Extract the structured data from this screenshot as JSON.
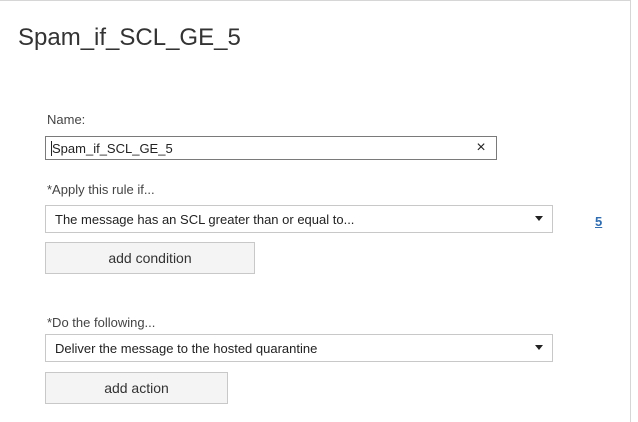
{
  "dialog": {
    "title": "Spam_if_SCL_GE_5"
  },
  "name_field": {
    "label": "Name:",
    "value": "Spam_if_SCL_GE_5",
    "clear_icon": "×"
  },
  "condition_section": {
    "label": "*Apply this rule if...",
    "selected": "The message has an SCL greater than or equal to...",
    "link_value": "5",
    "add_button": "add condition"
  },
  "action_section": {
    "label": "*Do the following...",
    "selected": "Deliver the message to the hosted quarantine",
    "add_button": "add action"
  },
  "colors": {
    "link": "#2f6db0",
    "button_background": "#f4f4f4",
    "border": "#c8c8c8"
  },
  "icons": {
    "clear": "close-icon",
    "dropdown": "chevron-down-icon"
  }
}
